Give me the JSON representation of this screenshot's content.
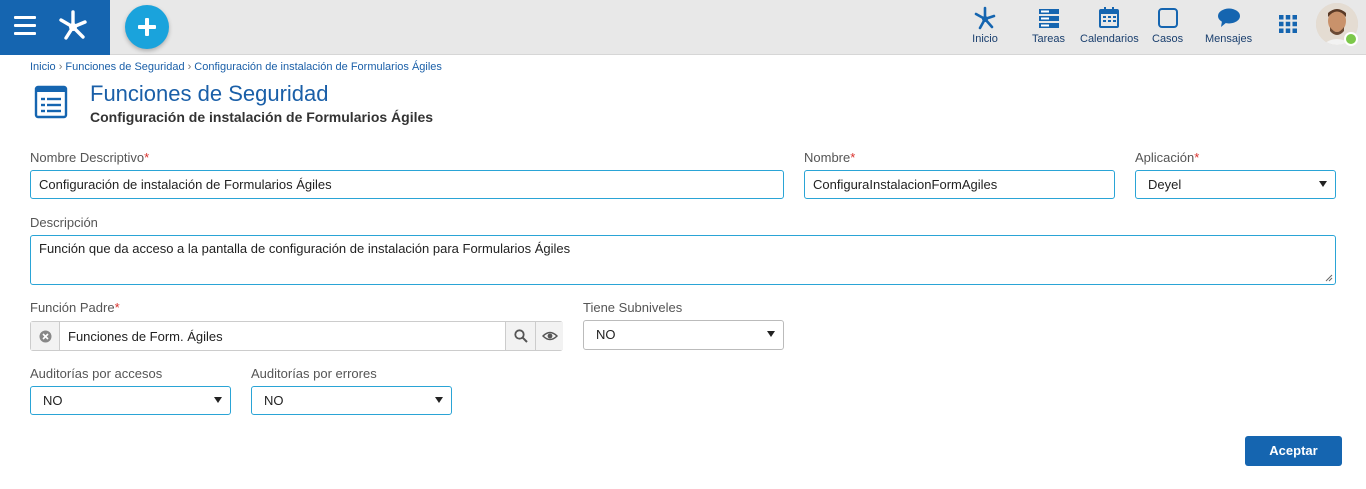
{
  "nav": {
    "items": [
      {
        "label": "Inicio",
        "icon": "deyel-home-icon"
      },
      {
        "label": "Tareas",
        "icon": "tasks-icon"
      },
      {
        "label": "Calendarios",
        "icon": "calendar-icon"
      },
      {
        "label": "Casos",
        "icon": "cases-icon"
      },
      {
        "label": "Mensajes",
        "icon": "chat-icon"
      }
    ]
  },
  "colors": {
    "brand": "#1565b0",
    "accent": "#1aa3dc",
    "link": "#1a5fa8",
    "required": "#d9302b",
    "online": "#7cc84a"
  },
  "breadcrumb": [
    "Inicio",
    "Funciones de Seguridad",
    "Configuración de instalación de Formularios Ágiles"
  ],
  "header": {
    "title": "Funciones de Seguridad",
    "subtitle": "Configuración de instalación de Formularios Ágiles"
  },
  "form": {
    "nombre_descriptivo": {
      "label": "Nombre Descriptivo",
      "required": "*",
      "value": "Configuración de instalación de Formularios Ágiles"
    },
    "nombre": {
      "label": "Nombre",
      "required": "*",
      "value": "ConfiguraInstalacionFormAgiles"
    },
    "aplicacion": {
      "label": "Aplicación",
      "required": "*",
      "value": "Deyel"
    },
    "descripcion": {
      "label": "Descripción",
      "value": "Función que da acceso a la pantalla de configuración de instalación para Formularios Ágiles"
    },
    "funcion_padre": {
      "label": "Función Padre",
      "required": "*",
      "value": "Funciones de Form. Ágiles"
    },
    "tiene_subniveles": {
      "label": "Tiene Subniveles",
      "value": "NO"
    },
    "auditorias_accesos": {
      "label": "Auditorías por accesos",
      "value": "NO"
    },
    "auditorias_errores": {
      "label": "Auditorías por errores",
      "value": "NO"
    }
  },
  "actions": {
    "accept_label": "Aceptar"
  }
}
